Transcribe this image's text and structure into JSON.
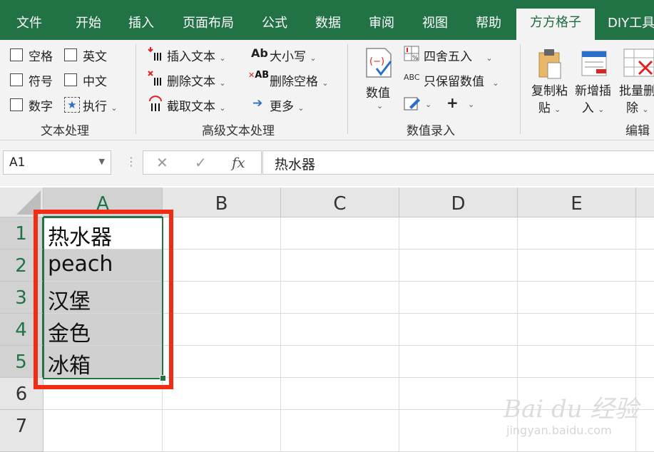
{
  "tabs": [
    "文件",
    "开始",
    "插入",
    "页面布局",
    "公式",
    "数据",
    "审阅",
    "视图",
    "帮助",
    "方方格子",
    "DIY工具"
  ],
  "active_tab": "方方格子",
  "ribbon": {
    "text_group": {
      "checkboxes": [
        "空格",
        "英文",
        "符号",
        "中文",
        "数字"
      ],
      "execute": "执行",
      "label": "文本处理"
    },
    "advanced_group": {
      "insert_text": "插入文本",
      "delete_text": "删除文本",
      "extract_text": "截取文本",
      "case": "大小写",
      "delete_space": "删除空格",
      "more": "更多",
      "case_icon": "Ab",
      "space_icon": "AB",
      "label": "高级文本处理"
    },
    "numeric_group": {
      "value_btn": "数值",
      "round": "四舍五入",
      "keep_values": "只保留数值",
      "abc": "ABC",
      "plus": "+",
      "label": "数值录入"
    },
    "edit_group": {
      "copy_paste_1": "复制粘",
      "copy_paste_2": "贴",
      "insert_1": "新增插",
      "insert_2": "入",
      "batch_delete_1": "批量删",
      "batch_delete_2": "除",
      "label": "编辑"
    }
  },
  "formula_bar": {
    "name_box": "A1",
    "cancel": "✕",
    "confirm": "✓",
    "fx": "fx",
    "formula": "热水器"
  },
  "grid": {
    "columns": [
      "A",
      "B",
      "C",
      "D",
      "E"
    ],
    "rows": [
      "1",
      "2",
      "3",
      "4",
      "5",
      "6",
      "7"
    ],
    "cells_a": [
      "热水器",
      "peach",
      "汉堡",
      "金色",
      "冰箱",
      "",
      ""
    ]
  },
  "watermark": {
    "logo": "Bai du 经验",
    "url": "jingyan.baidu.com"
  },
  "colors": {
    "excel_green": "#217346",
    "highlight_red": "#f02b16",
    "selection_gray": "#d0d0d0"
  }
}
